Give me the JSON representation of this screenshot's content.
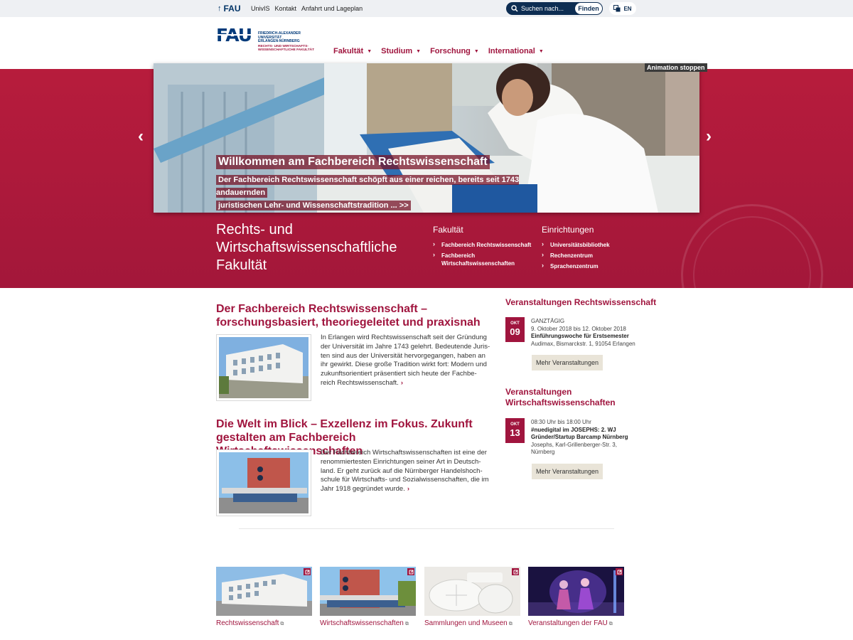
{
  "topbar": {
    "fau": "FAU",
    "links": [
      "UnivIS",
      "Kontakt",
      "Anfahrt und Lageplan"
    ],
    "search_placeholder": "Suchen nach...",
    "search_button": "Finden",
    "lang": "EN"
  },
  "header": {
    "logo_mark": "FAU",
    "logo_uni": [
      "FRIEDRICH-ALEXANDER",
      "UNIVERSITÄT",
      "ERLANGEN-NÜRNBERG"
    ],
    "logo_faculty": [
      "RECHTS- UND WIRTSCHAFTS-",
      "WISSENSCHAFTLICHE FAKULTÄT"
    ],
    "nav": [
      "Fakultät",
      "Studium",
      "Forschung",
      "International"
    ]
  },
  "hero": {
    "animation_stop": "Animation stoppen",
    "slide_title": "Willkommen am Fachbereich Rechtswissenschaft",
    "slide_text_1": "Der Fachbereich Rechtswissenschaft schöpft aus einer reichen, bereits seit 1743 andauernden",
    "slide_text_2": "juristischen Lehr- und Wissenschaftstradition ... >>",
    "faculty_title": "Rechts- und Wirtschaftswissenschaftliche Fakultät",
    "col1_head": "Fakultät",
    "col1_items": [
      "Fachbereich Rechtswissenschaft",
      "Fachbereich Wirtschaftswissenschaften"
    ],
    "col2_head": "Einrichtungen",
    "col2_items": [
      "Universitätsbibliothek",
      "Rechenzentrum",
      "Sprachenzentrum"
    ]
  },
  "articles": [
    {
      "title": "Der Fachbereich Rechtswissenschaft – forschungsbasiert, theoriegeleitet und praxisnah",
      "lines": [
        "In Erlangen wird Rechtswissenschaft seit der Gründung",
        "der Universität im Jahre 1743 gelehrt. Bedeutende Juris-",
        "ten sind aus der Universität hervorgegangen, haben an",
        "ihr gewirkt. Diese große Tradition wirkt fort: Modern und",
        "zukunftsorientiert präsentiert sich heute der Fachbe-",
        "reich Rechtswissenschaft."
      ]
    },
    {
      "title": "Die Welt im Blick – Exzellenz im Fokus. Zukunft gestalten am Fachbereich Wirtschaftswissenschaften",
      "lines": [
        "Der Fachbereich Wirtschaftswissenschaften ist eine der",
        "renommiertesten Einrichtungen seiner Art in Deutsch-",
        "land. Er geht zurück auf die Nürnberger Handelshoch-",
        "schule für Wirtschafts- und Sozialwissenschaften, die im",
        "Jahr 1918 gegründet wurde."
      ]
    }
  ],
  "events": [
    {
      "head": "Veranstaltungen Rechtswissenschaft",
      "month": "OKT",
      "day": "09",
      "time": "GANZTÄGIG",
      "dates": "9. Oktober 2018 bis 12. Oktober 2018",
      "title": "Einführungswoche für Erstsemester",
      "place": "Audimax, Bismarckstr. 1, 91054 Erlangen",
      "button": "Mehr Veranstaltungen"
    },
    {
      "head_1": "Veranstaltungen",
      "head_2": "Wirtschaftswissenschaften",
      "month": "OKT",
      "day": "13",
      "time": "08:30 Uhr bis 18:00 Uhr",
      "title_1": "#nuedigital im JOSEPHS: 2. WJ",
      "title_2": "Gründer/Startup Barcamp Nürnberg",
      "place_1": "Josephs, Karl-Grillenberger-Str. 3,",
      "place_2": "Nürnberg",
      "button": "Mehr Veranstaltungen"
    }
  ],
  "tiles": [
    "Rechtswissenschaft",
    "Wirtschaftswissenschaften",
    "Sammlungen und Museen",
    "Veranstaltungen der FAU"
  ],
  "colors": {
    "brand_red": "#a0153e",
    "navy": "#003a7a",
    "hero_band": "#b71c3c"
  }
}
